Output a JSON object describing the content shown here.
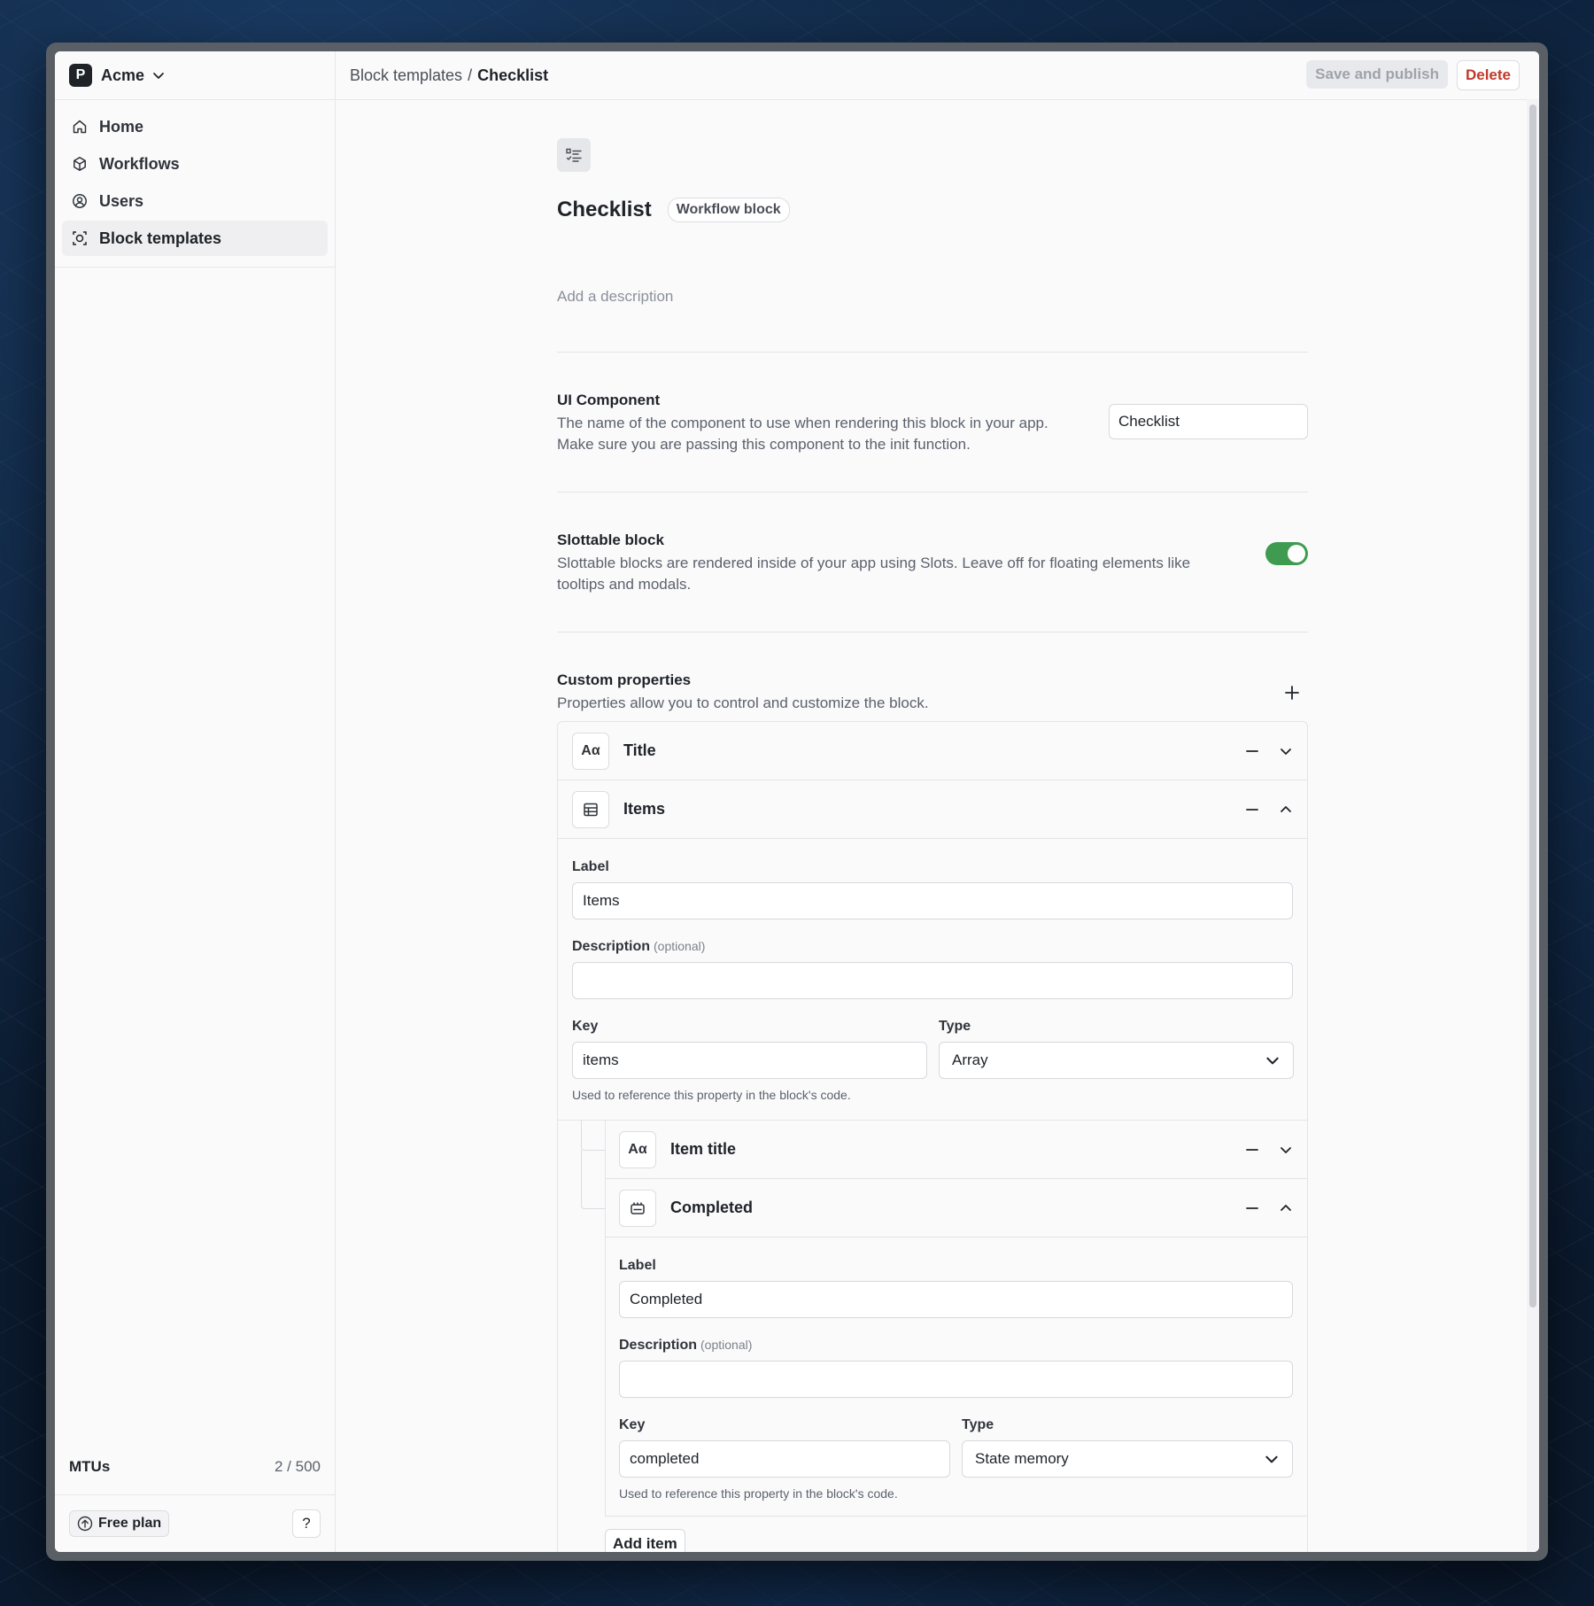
{
  "workspace": {
    "logo_letter": "P",
    "name": "Acme"
  },
  "sidebar": {
    "items": [
      {
        "label": "Home",
        "icon": "home-icon"
      },
      {
        "label": "Workflows",
        "icon": "cube-icon"
      },
      {
        "label": "Users",
        "icon": "user-circle-icon"
      },
      {
        "label": "Block templates",
        "icon": "block-template-icon",
        "active": true
      }
    ],
    "mtus": {
      "label": "MTUs",
      "value": "2 / 500"
    },
    "plan_label": "Free plan",
    "help_label": "?"
  },
  "breadcrumb": {
    "parent": "Block templates",
    "separator": "/",
    "current": "Checklist"
  },
  "toolbar": {
    "save_label": "Save and publish",
    "delete_label": "Delete"
  },
  "block": {
    "title": "Checklist",
    "badge": "Workflow block",
    "description_placeholder": "Add a description"
  },
  "ui_component": {
    "title": "UI Component",
    "description": "The name of the component to use when rendering this block in your app. Make sure you are passing this component to the init function.",
    "value": "Checklist"
  },
  "slottable": {
    "title": "Slottable block",
    "description": "Slottable blocks are rendered inside of your app using Slots. Leave off for floating elements like tooltips and modals.",
    "enabled": true
  },
  "custom_properties": {
    "title": "Custom properties",
    "description": "Properties allow you to control and customize the block.",
    "props": [
      {
        "icon_text": "Aα",
        "label": "Title",
        "expanded": false
      },
      {
        "icon_text": "",
        "label": "Items",
        "expanded": true
      }
    ],
    "items_detail": {
      "label_field": "Label",
      "label_value": "Items",
      "description_field": "Description",
      "optional": "(optional)",
      "description_value": "",
      "key_field": "Key",
      "key_value": "items",
      "type_field": "Type",
      "type_value": "Array",
      "help": "Used to reference this property in the block's code."
    },
    "children": [
      {
        "icon_text": "Aα",
        "label": "Item title",
        "expanded": false
      },
      {
        "icon_text": "",
        "label": "Completed",
        "expanded": true
      }
    ],
    "completed_detail": {
      "label_field": "Label",
      "label_value": "Completed",
      "description_field": "Description",
      "optional": "(optional)",
      "description_value": "",
      "key_field": "Key",
      "key_value": "completed",
      "type_field": "Type",
      "type_value": "State memory",
      "help": "Used to reference this property in the block's code."
    },
    "add_item_label": "Add item"
  },
  "colors": {
    "toggle_on": "#3f9b4f",
    "danger": "#c0392b"
  }
}
